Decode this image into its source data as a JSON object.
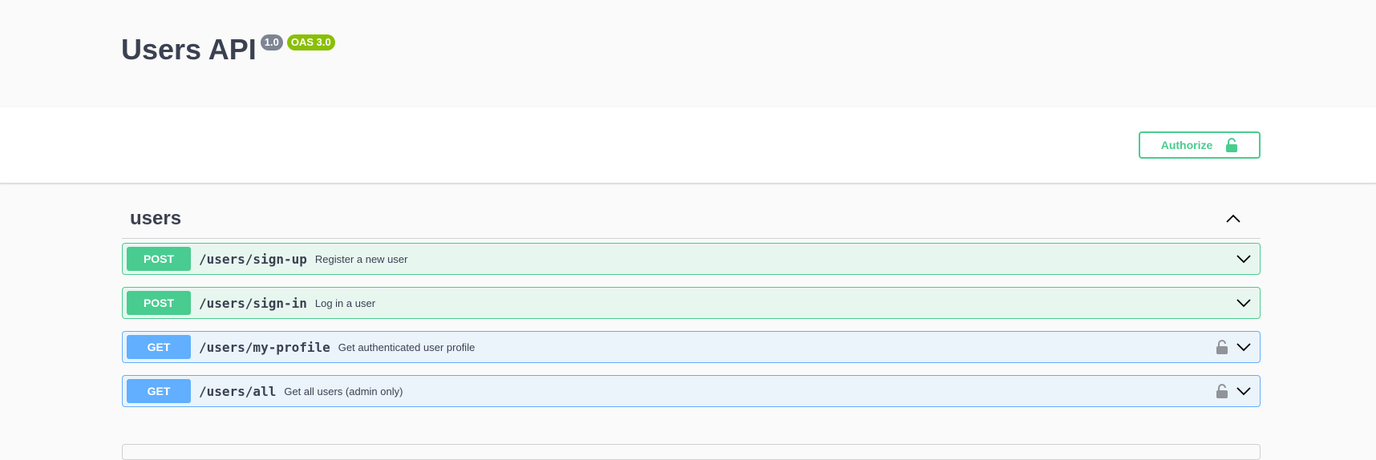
{
  "info": {
    "title": "Users API",
    "version": "1.0",
    "oas": "OAS 3.0"
  },
  "scheme": {
    "authorize_label": "Authorize"
  },
  "tag": {
    "name": "users",
    "expanded": true
  },
  "operations": [
    {
      "method": "POST",
      "path": "/users/sign-up",
      "summary": "Register a new user",
      "locked": false
    },
    {
      "method": "POST",
      "path": "/users/sign-in",
      "summary": "Log in a user",
      "locked": false
    },
    {
      "method": "GET",
      "path": "/users/my-profile",
      "summary": "Get authenticated user profile",
      "locked": true
    },
    {
      "method": "GET",
      "path": "/users/all",
      "summary": "Get all users (admin only)",
      "locked": true
    }
  ],
  "colors": {
    "post": "#49cc90",
    "get": "#61affe",
    "version_badge": "#7d8492",
    "oas_badge": "#89bf04"
  },
  "icons": {
    "authorize": "unlock-icon",
    "tag_toggle": "chevron-up-icon",
    "op_toggle": "chevron-down-icon",
    "op_lock": "lock-icon"
  }
}
